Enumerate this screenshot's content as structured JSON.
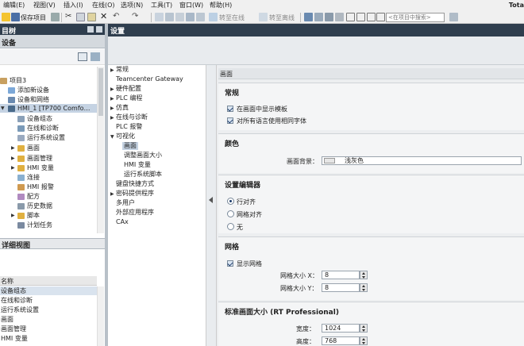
{
  "menu": {
    "items": [
      "编辑(E)",
      "视图(V)",
      "插入(I)",
      "在线(O)",
      "选项(N)",
      "工具(T)",
      "窗口(W)",
      "帮助(H)"
    ],
    "app_title": "Tota"
  },
  "toolbar": {
    "save_label": "保存项目",
    "go_online": "转至在线",
    "go_offline": "转至离线",
    "search_placeholder": "<在项目中搜索>"
  },
  "project_tree": {
    "title": "目树",
    "tab": "设备",
    "items": [
      {
        "label": "项目3",
        "indent": 0
      },
      {
        "label": "添加新设备",
        "indent": 1
      },
      {
        "label": "设备和网络",
        "indent": 1
      },
      {
        "label": "HMI_1 [TP700 Comfo…",
        "indent": 0
      },
      {
        "label": "设备组态",
        "indent": 2
      },
      {
        "label": "在线和诊断",
        "indent": 2
      },
      {
        "label": "运行系统设置",
        "indent": 2
      },
      {
        "label": "画面",
        "indent": 2
      },
      {
        "label": "画面管理",
        "indent": 2
      },
      {
        "label": "HMI 变量",
        "indent": 2
      },
      {
        "label": "连接",
        "indent": 2
      },
      {
        "label": "HMI 报警",
        "indent": 2
      },
      {
        "label": "配方",
        "indent": 2
      },
      {
        "label": "历史数据",
        "indent": 2
      },
      {
        "label": "脚本",
        "indent": 2
      },
      {
        "label": "计划任务",
        "indent": 2
      }
    ]
  },
  "detail_view": {
    "title": "详细视图",
    "column": "名称",
    "rows": [
      "设备组态",
      "在线和诊断",
      "运行系统设置",
      "画面",
      "画面管理",
      "HMI 变量"
    ]
  },
  "settings": {
    "title": "设置",
    "nav": [
      "常规",
      "Teamcenter Gateway",
      "硬件配置",
      "PLC 编程",
      "仿真",
      "在线与诊断",
      "PLC 报警",
      "可视化",
      "画面",
      "调整画面大小",
      "HMI 变量",
      "运行系统脚本",
      "键盘快捷方式",
      "密码提供程序",
      "多用户",
      "外部应用程序",
      "CAx"
    ],
    "panel_heading": "画面",
    "sections": {
      "general": {
        "title": "常规",
        "show_template": "在画面中显示模板",
        "same_font": "对所有语言使用相同字体"
      },
      "color": {
        "title": "颜色",
        "bg_label": "画面背景：",
        "bg_value": "浅灰色",
        "bg_swatch": "#e6e6e6"
      },
      "editor": {
        "title": "设置编辑器",
        "opt_row": "行对齐",
        "opt_grid": "网格对齐",
        "opt_none": "无",
        "selected": "行对齐"
      },
      "grid": {
        "title": "网格",
        "show_grid": "显示网格",
        "size_x_label": "网格大小 X：",
        "size_x": "8",
        "size_y_label": "网格大小 Y：",
        "size_y": "8"
      },
      "size": {
        "title": "标准画面大小 (RT Professional)",
        "width_label": "宽度：",
        "width": "1024",
        "height_label": "高度：",
        "height": "768"
      }
    }
  },
  "colors": {
    "header_dark": "#2f3e4e",
    "selection": "#c5d3e3"
  }
}
